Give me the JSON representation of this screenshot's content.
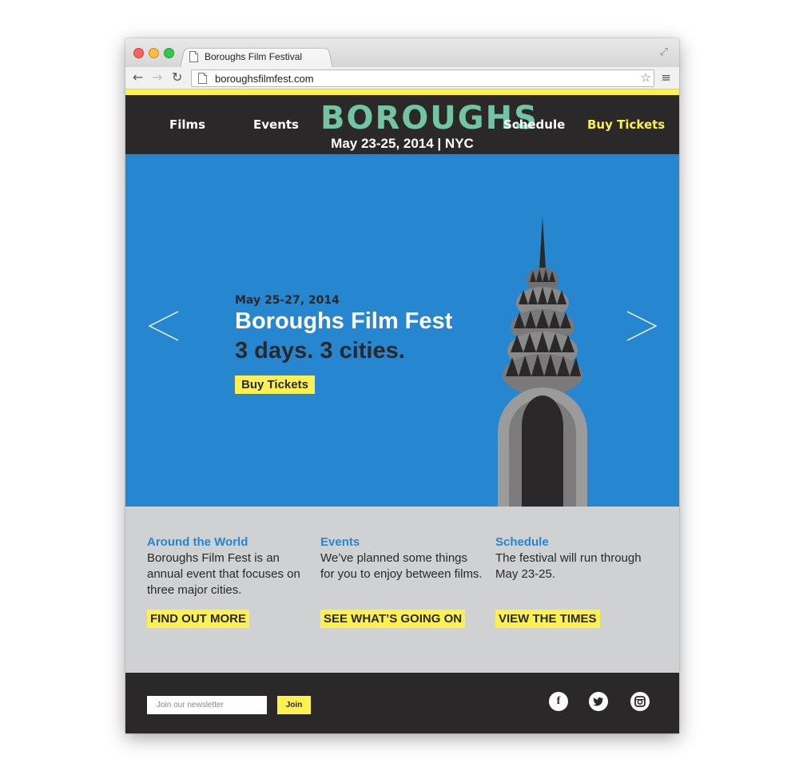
{
  "browser": {
    "tab_title": "Boroughs Film Festival",
    "url": "boroughsfilmfest.com",
    "icons": [
      "back-icon",
      "forward-icon",
      "reload-icon",
      "star-icon",
      "menu-icon",
      "expand-icon"
    ]
  },
  "nav": {
    "items": [
      {
        "label": "Films"
      },
      {
        "label": "Events"
      },
      {
        "label": "Schedule"
      },
      {
        "label": "Buy Tickets"
      }
    ],
    "logo": "BOROUGHS",
    "logo_date": "May 23-25, 2014 | NYC"
  },
  "hero": {
    "date": "May 25-27, 2014",
    "title": "Boroughs Film Fest",
    "subtitle": "3 days. 3 cities.",
    "button": "Buy Tickets"
  },
  "features": [
    {
      "heading": "Around the World",
      "body": "Boroughs Film Fest is an annual event that focuses on three major cities.",
      "cta": "FIND OUT MORE"
    },
    {
      "heading": "Events",
      "body": "We’ve planned some things for you to enjoy between films.",
      "cta": "SEE WHAT’S GOING ON"
    },
    {
      "heading": "Schedule",
      "body": "The festival will run through May 23-25.",
      "cta": "VIEW THE TIMES"
    }
  ],
  "footer": {
    "newsletter_placeholder": "Join our newsletter",
    "join_label": "Join",
    "social": [
      {
        "icon": "facebook-icon",
        "glyph": "f"
      },
      {
        "icon": "twitter-icon",
        "glyph": "t"
      },
      {
        "icon": "instagram-icon",
        "glyph": "◎"
      }
    ]
  },
  "colors": {
    "yellow": "#fcf150",
    "dark": "#2a2829",
    "blue": "#2686d0",
    "mint": "#72c4a5",
    "gray": "#d0d1d3"
  }
}
